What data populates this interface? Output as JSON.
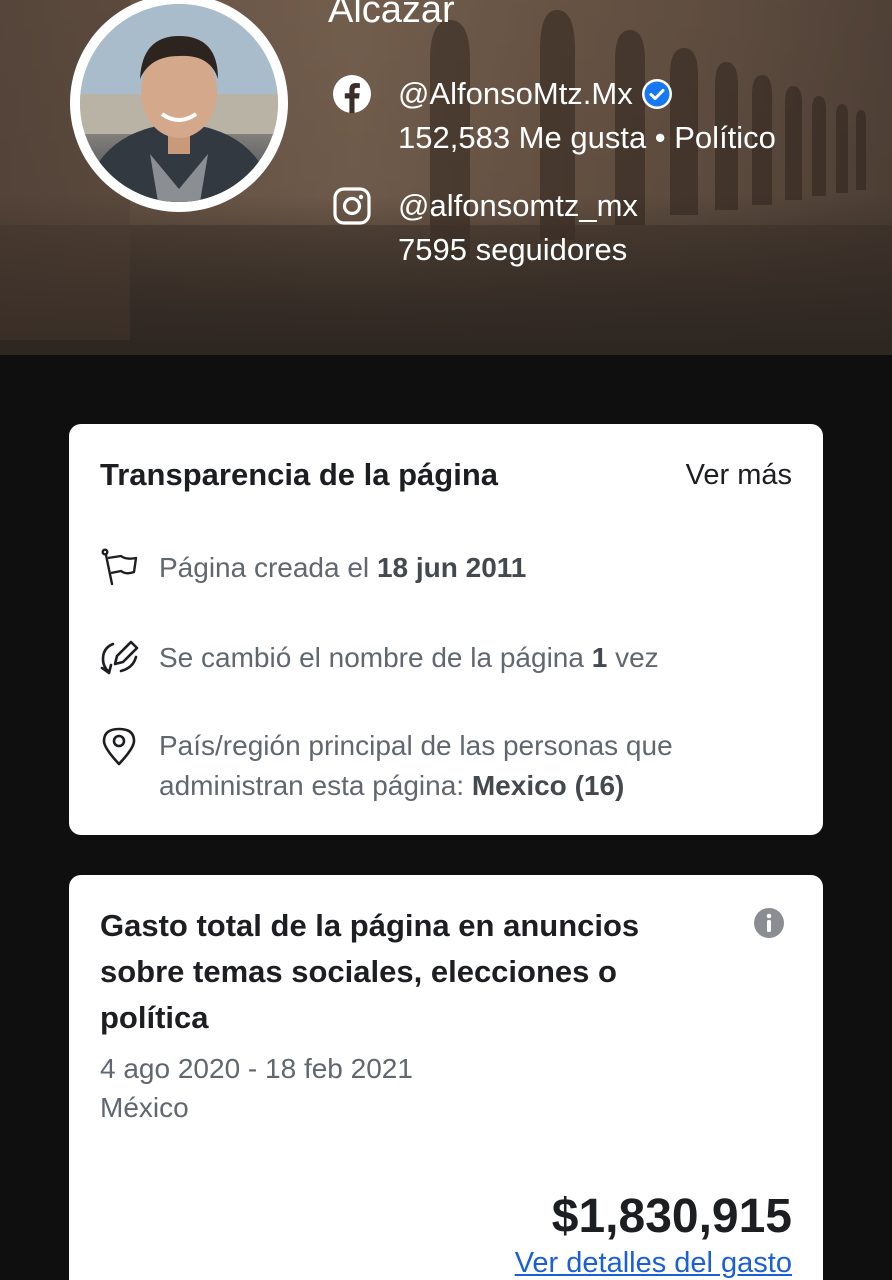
{
  "header": {
    "name": "Alcázar",
    "facebook": {
      "handle": "@AlfonsoMtz.Mx",
      "stats": "152,583 Me gusta • Político"
    },
    "instagram": {
      "handle": "@alfonsomtz_mx",
      "stats": "7595 seguidores"
    }
  },
  "transparency": {
    "title": "Transparencia de la página",
    "see_more": "Ver más",
    "created_prefix": "Página creada el",
    "created_date": "18 jun 2011",
    "name_change_prefix": "Se cambió el nombre de la página",
    "name_change_count": "1",
    "name_change_suffix": "vez",
    "admin_region_prefix": "País/región principal de las personas que administran esta página:",
    "admin_region_value": "Mexico (16)"
  },
  "ad_spend": {
    "title": "Gasto total de la página en anuncios sobre temas sociales, elecciones o política",
    "date_range": "4 ago 2020 - 18 feb 2021",
    "country": "México",
    "amount": "$1,830,915",
    "details_link": "Ver detalles del gasto"
  },
  "colors": {
    "link": "#1a5fd6",
    "verified": "#1877f2",
    "card_bg": "#ffffff",
    "page_bg": "#0f0f0f"
  },
  "icons": [
    "facebook-icon",
    "verified-badge-icon",
    "instagram-icon",
    "flag-icon",
    "edit-icon",
    "location-pin-icon",
    "info-icon"
  ]
}
